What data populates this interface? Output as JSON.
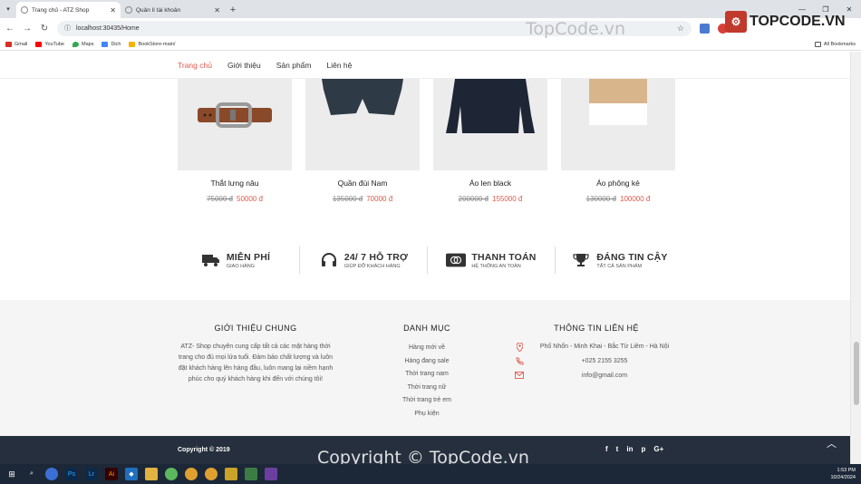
{
  "browser": {
    "tabs": [
      {
        "title": "Trang chủ - ATZ Shop",
        "active": true
      },
      {
        "title": "Quản lí tài khoản",
        "active": false
      }
    ],
    "url": "localhost:30435/Home",
    "bookmarks": [
      {
        "label": "Gmail",
        "color": "#d93025"
      },
      {
        "label": "YouTube",
        "color": "#ff0000"
      },
      {
        "label": "Maps",
        "color": "#34a853"
      },
      {
        "label": "Dịch",
        "color": "#4285f4"
      },
      {
        "label": "BookStore-main/",
        "color": "#f4b400"
      }
    ],
    "all_bookmarks": "All Bookmarks"
  },
  "watermark": "TopCode.vn",
  "logo_text": "TOPCODE.VN",
  "nav": {
    "items": [
      "Trang chủ",
      "Giới thiệu",
      "Sản phẩm",
      "Liên hệ"
    ],
    "active_index": 0,
    "accent": "#e05a4c"
  },
  "products": [
    {
      "name": "Thắt lưng nâu",
      "old_price": "75000 đ",
      "new_price": "50000 đ"
    },
    {
      "name": "Quần đùi Nam",
      "old_price": "135000 đ",
      "new_price": "70000 đ"
    },
    {
      "name": "Áo len black",
      "old_price": "200000 đ",
      "new_price": "155000 đ"
    },
    {
      "name": "Áo phông kẻ",
      "old_price": "130000 đ",
      "new_price": "100000 đ"
    }
  ],
  "features": [
    {
      "title": "MIỄN PHÍ",
      "subtitle": "GIAO HÀNG",
      "icon": "truck-icon"
    },
    {
      "title": "24/ 7 HỖ TRỢ",
      "subtitle": "GIÚP ĐỠ KHÁCH HÀNG",
      "icon": "headphones-icon"
    },
    {
      "title": "THANH TOÁN",
      "subtitle": "HỆ THỐNG AN TOÀN",
      "icon": "card-icon"
    },
    {
      "title": "ĐÁNG TIN CẬY",
      "subtitle": "TẤT CẢ SẢN PHẨM",
      "icon": "trophy-icon"
    }
  ],
  "footer": {
    "about_title": "GIỚI THIỆU CHUNG",
    "about_text": "ATZ- Shop chuyên cung cấp tất cả các mặt hàng thời trang cho đủ mọi lứa tuổi. Đảm bảo chất lượng và luôn đặt khách hàng lên hàng đầu, luôn mang lại niềm hạnh phúc cho quý khách hàng khi đến với chúng tôi!",
    "category_title": "DANH MỤC",
    "categories": [
      "Hàng mới về",
      "Hàng đang sale",
      "Thời trang nam",
      "Thời trang nữ",
      "Thời trang trẻ em",
      "Phụ kiện"
    ],
    "contact_title": "THÔNG TIN LIÊN HỆ",
    "address": "Phố Nhổn - Minh Khai - Bắc Từ Liêm - Hà Nội",
    "phone": "+025 2155 3255",
    "email": "info@gmail.com",
    "copyright": "Copyright © 2019",
    "social": [
      "f",
      "t",
      "in",
      "p",
      "G+"
    ]
  },
  "taskbar": {
    "time": "1:53 PM",
    "date": "10/24/2024"
  }
}
